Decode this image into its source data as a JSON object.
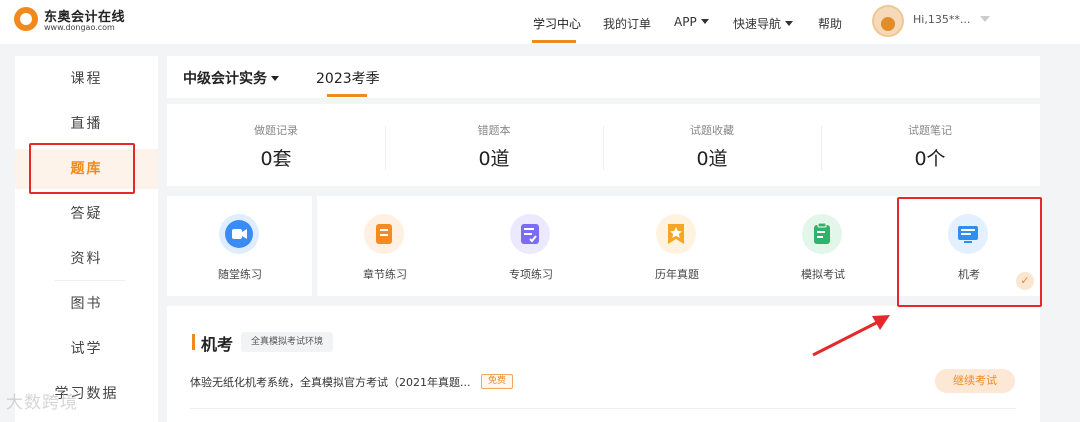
{
  "header": {
    "logo_cn": "东奥会计在线",
    "logo_en": "www.dongao.com",
    "nav": [
      {
        "label": "学习中心"
      },
      {
        "label": "我的订单"
      },
      {
        "label": "APP"
      },
      {
        "label": "快速导航"
      },
      {
        "label": "帮助"
      }
    ],
    "username": "Hi,135**..."
  },
  "sidebar": {
    "items": [
      {
        "label": "课程"
      },
      {
        "label": "直播"
      },
      {
        "label": "题库"
      },
      {
        "label": "答疑"
      },
      {
        "label": "资料"
      },
      {
        "label": "图书"
      },
      {
        "label": "试学"
      },
      {
        "label": "学习数据"
      }
    ]
  },
  "subject_bar": {
    "subject": "中级会计实务",
    "season": "2023考季"
  },
  "stats": [
    {
      "label": "做题记录",
      "value": "0套"
    },
    {
      "label": "错题本",
      "value": "0道"
    },
    {
      "label": "试题收藏",
      "value": "0道"
    },
    {
      "label": "试题笔记",
      "value": "0个"
    }
  ],
  "modes": [
    {
      "label": "随堂练习",
      "icon": "video-icon",
      "bg": "#e3efff",
      "color": "#3a8bf5"
    },
    {
      "label": "章节练习",
      "icon": "book-icon",
      "bg": "#fff0e2",
      "color": "#f58a1e"
    },
    {
      "label": "专项练习",
      "icon": "checklist-icon",
      "bg": "#ece9ff",
      "color": "#7b6cf5"
    },
    {
      "label": "历年真题",
      "icon": "star-bookmark-icon",
      "bg": "#fff3df",
      "color": "#f5a623"
    },
    {
      "label": "模拟考试",
      "icon": "clipboard-icon",
      "bg": "#e2f6ea",
      "color": "#2fb36a"
    },
    {
      "label": "机考",
      "icon": "monitor-icon",
      "bg": "#e3f0ff",
      "color": "#2f8ff0"
    }
  ],
  "section": {
    "title": "机考",
    "tag": "全真模拟考试环境",
    "description": "体验无纸化机考系统，全真模拟官方考试（2021年真题...",
    "free_tag": "免费",
    "continue_button": "继续考试"
  },
  "watermark": "大数跨境",
  "colors": {
    "accent": "#f08a1c",
    "highlight": "#e5292b"
  }
}
